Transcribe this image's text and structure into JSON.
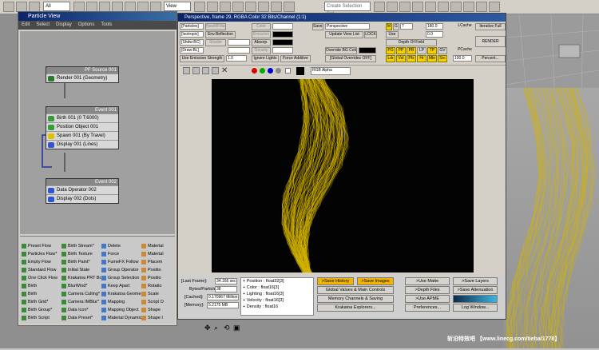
{
  "toolbar": {
    "filter_value": "All",
    "view_value": "View",
    "selection_set_placeholder": "Create Selection Set"
  },
  "particle_view": {
    "title": "Particle View",
    "menu": [
      "Edit",
      "Select",
      "Display",
      "Options",
      "Tools"
    ],
    "nodes": {
      "pf_source": {
        "header": "PF Source 001",
        "rows": [
          "Render 001 (Geometry)"
        ]
      },
      "event1": {
        "header": "Event 001",
        "rows": [
          "Birth 001 (0 T:6000)",
          "Position Object 001",
          "Spawn 001 (By Travel)",
          "Display 001 (Lines)"
        ]
      },
      "event2": {
        "header": "Event 002",
        "rows": [
          "Data Operator 002",
          "Display 002 (Dots)"
        ]
      }
    },
    "depot": [
      [
        "Preset Flow",
        "Birth Stream*",
        "Delete",
        "Material"
      ],
      [
        "Particles Flow*",
        "Birth Texture",
        "Force",
        "Material"
      ],
      [
        "Empty Flow",
        "Birth Paint*",
        "FumeFX Follow",
        "Placem"
      ],
      [
        "Standard Flow",
        "Initial State",
        "Group Operator",
        "Positio"
      ],
      [
        "One Click Flow",
        "Krakatoa PRT Br...",
        "Group Selection",
        "Positio"
      ],
      [
        "Birth",
        "BlurWind*",
        "Keep Apart",
        "Rotatio"
      ],
      [
        "Birth",
        "Camera Culling*",
        "Krakatoa Geome...",
        "Scale"
      ],
      [
        "Birth Grid*",
        "Camera IMBlur*",
        "Mapping",
        "Script O"
      ],
      [
        "Birth Group*",
        "Data Icon*",
        "Mapping Object",
        "Shape"
      ],
      [
        "Birth Script",
        "Data Preset*",
        "Material Dynamic",
        "Shape I"
      ]
    ]
  },
  "render_frame": {
    "title": "Perspective, frame 29, RGBA Color 32 Bits/Channel (1:1)",
    "row1": [
      "[Particles]",
      "NewMFilter",
      "Save...",
      "Color",
      "O",
      "Perspective",
      "M",
      "G",
      "7",
      "180.0",
      "LCache",
      "Iterative Full"
    ],
    "row2": [
      "[Isotropic]",
      "Env.Reflection",
      "Shader",
      "Emission",
      "Update View List",
      "LOCK",
      "Use",
      "0.0"
    ],
    "row3": [
      "[Shdw:BC]",
      "Absorp.",
      "Depth Of Field",
      "RENDER"
    ],
    "row4": [
      "[Draw:BL]",
      "Density",
      "Override BG Color",
      "PCache"
    ],
    "row5": [
      "Use Emission Strength",
      "1.0",
      "Ignore Lights",
      "Force Additive",
      "[Global Overrides OFF]",
      "Percent...",
      "100.0"
    ],
    "pgbtns": [
      "PG",
      "PP",
      "PB",
      "LP",
      "TP",
      "GV"
    ],
    "ldbtns": [
      "Ldr",
      "Vol",
      "Pfx",
      "Hr",
      "Mkr",
      "Src"
    ],
    "channel_value": "RGB Alpha",
    "stats": {
      "last_frame_label": "[Last Frame]:",
      "last_frame": "34.166 sec.",
      "bytes_label": "Bytes/Particle:",
      "bytes": "38",
      "cached_label": "[Cached]:",
      "cached": "0.170967 Million",
      "memory_label": "[Memory]:",
      "memory": "5.2175 MB"
    },
    "channels": [
      "+ Position  : float32[3]",
      "+ Color  : float16[3]",
      "+ Lighting  : float16[3]",
      "+ Velocity  : float16[3]",
      "+ Density  : float16"
    ],
    "buttons": {
      "save_history": ">Save History",
      "save_images": ">Save Images",
      "use_matte": ">Use Matte",
      "save_layers": ">Save Layers",
      "global_values": "Global Values & Main Controls",
      "depth_files": ">Depth Files",
      "save_attenuation": ">Save Attenuation",
      "memory_channels": "Memory Channels & Saving",
      "use_apme": ">Use APME",
      "krakatoa_explorers": "Krakatoa Explorers...",
      "preferences": "Preferences...",
      "log_window": "Log Window..."
    }
  },
  "watermark": "斩沿特效吧 【www.linecg.com/tieba/1778】",
  "colors": {
    "accent": "#f2b400",
    "particles": "#d4b400",
    "titlebar": "#0a246a"
  }
}
